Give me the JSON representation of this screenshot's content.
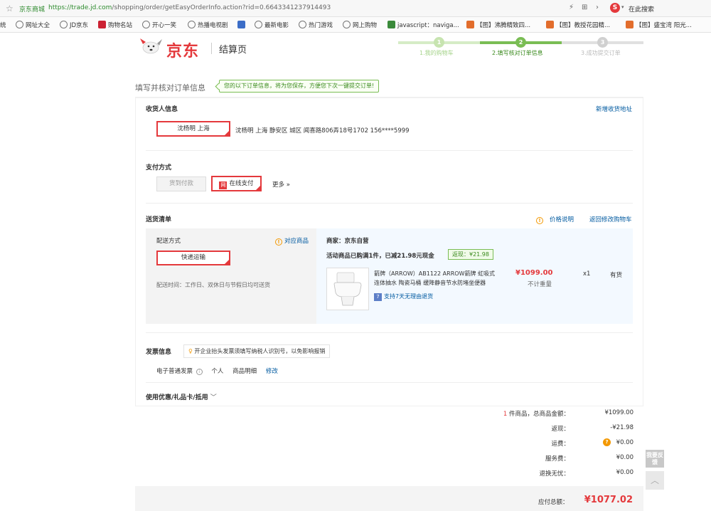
{
  "browser": {
    "site_label": "京东商城",
    "url_host": "https://trade.jd.com",
    "url_path": "/shopping/order/getEasyOrderInfo.action?rid=0.6643341237914493",
    "search_placeholder": "在此搜索",
    "bookmarks": [
      {
        "label": "统",
        "icon": "none"
      },
      {
        "label": "网址大全",
        "icon": "globe-icon"
      },
      {
        "label": "JD京东",
        "icon": "globe-icon"
      },
      {
        "label": "购物名站",
        "icon": "shop-icon"
      },
      {
        "label": "开心一笑",
        "icon": "globe-icon"
      },
      {
        "label": "热播电视剧",
        "icon": "globe-icon"
      },
      {
        "label": "",
        "icon": "image-icon"
      },
      {
        "label": "最新电影",
        "icon": "globe-icon"
      },
      {
        "label": "热门游戏",
        "icon": "globe-icon"
      },
      {
        "label": "网上购物",
        "icon": "globe-icon"
      },
      {
        "label": "javascript：naviga...",
        "icon": "script-icon"
      },
      {
        "label": "【图】沸腾精致四...",
        "icon": "page-icon"
      },
      {
        "label": "【图】教授花园精...",
        "icon": "page-icon"
      },
      {
        "label": "【图】盛宝湾 阳光...",
        "icon": "page-icon"
      }
    ]
  },
  "header": {
    "logo_text": "京东",
    "subtitle": "结算页",
    "steps": [
      {
        "num": "1",
        "label": "1.我的购物车",
        "state": "done"
      },
      {
        "num": "2",
        "label": "2.填写核对订单信息",
        "state": "current"
      },
      {
        "num": "3",
        "label": "3.成功提交订单",
        "state": "todo"
      }
    ]
  },
  "order": {
    "title": "填写并核对订单信息",
    "tip": "您的以下订单信息，将为您保存，方便您下次一键提交订单!",
    "consignee": {
      "heading": "收货人信息",
      "add_link": "新增收货地址",
      "selected_name": "沈杨明 上海",
      "address_line": "沈杨明    上海 静安区 城区 闻喜路806弄18号1702    156****5999"
    },
    "payment": {
      "heading": "支付方式",
      "cod_label": "货到付款",
      "online_label": "在线支付",
      "online_icon": "网",
      "more_label": "更多 »"
    },
    "shipping": {
      "heading": "送货清单",
      "price_note_link": "价格说明",
      "back_cart_link": "返回修改购物车",
      "method_label": "配送方式",
      "match_link": "对应商品",
      "method_selected": "快递运输",
      "delivery_time": "配送时间：工作日、双休日与节假日均可送货",
      "merchant": "商家：京东自营",
      "promo": "活动商品已购满1件，已减21.98元现金",
      "rebate": "返现：¥21.98",
      "product_name": "箭牌（ARROW）AB1122 ARROW箭牌 虹吸式连体抽水 陶瓷马桶 缓降静音节水防堵坐便器",
      "price": "¥1099.00",
      "weight": "不计重量",
      "qty": "x1",
      "stock": "有货",
      "return_badge": "7",
      "return_text": "支持7天无理由退货"
    },
    "invoice": {
      "heading": "发票信息",
      "tip": "开企业抬头发票须填写纳税人识别号，以免影响报销",
      "type": "电子普通发票",
      "info_icon": "i",
      "title": "个人",
      "content": "商品明细",
      "edit_link": "修改"
    },
    "coupon": {
      "heading": "使用优惠/礼品卡/抵用"
    }
  },
  "summary": {
    "items_count": "1",
    "items_label_rest": " 件商品，总商品金额：",
    "items_amount": "¥1099.00",
    "rebate_label": "返现：",
    "rebate_amount": "-¥21.98",
    "freight_label": "运费：",
    "freight_amount": "¥0.00",
    "service_label": "服务费：",
    "service_amount": "¥0.00",
    "return_label": "退换无忧：",
    "return_amount": "¥0.00",
    "total_label": "应付总额：",
    "total_amount": "¥1077.02"
  },
  "side": {
    "feedback": "我要反馈",
    "to_top_icon": "︿"
  },
  "colors": {
    "brand_red": "#e4393c",
    "step_green": "#7abd54",
    "link_blue": "#005aa0"
  }
}
